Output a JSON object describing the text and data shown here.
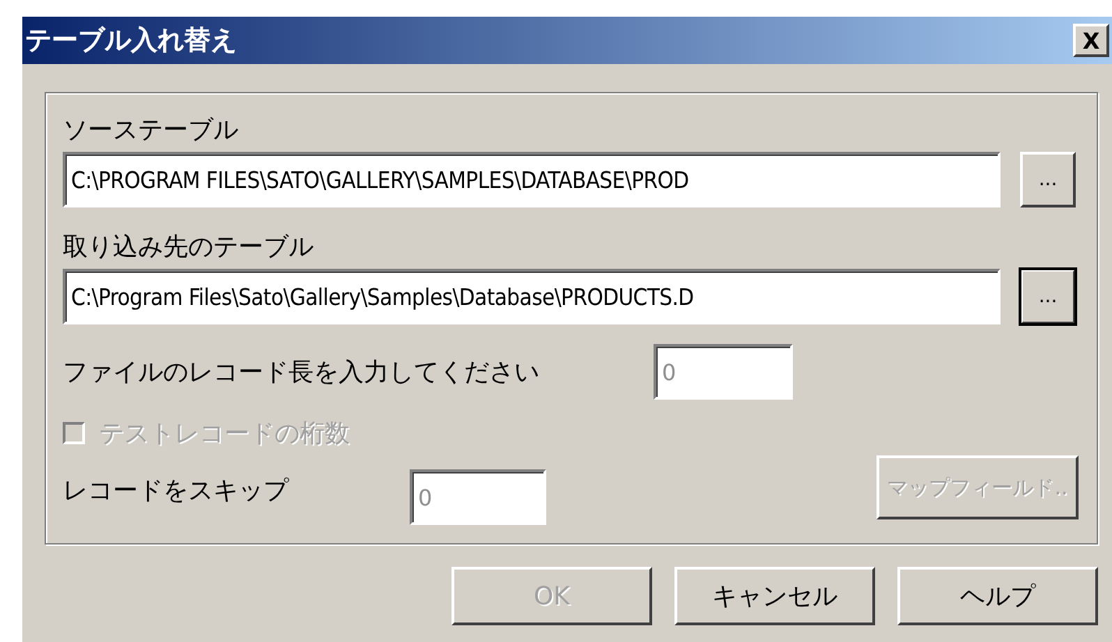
{
  "window": {
    "title": "テーブル入れ替え",
    "close": "X"
  },
  "source": {
    "label": "ソーステーブル",
    "value": "C:\\PROGRAM FILES\\SATO\\GALLERY\\SAMPLES\\DATABASE\\PROD",
    "browse": {
      "label": "...",
      "focused": false
    }
  },
  "target": {
    "label": "取り込み先のテーブル",
    "value": "C:\\Program Files\\Sato\\Gallery\\Samples\\Database\\PRODUCTS.D",
    "browse": {
      "label": "...",
      "focused": true
    }
  },
  "record_length": {
    "label": "ファイルのレコード長を入力してください",
    "value": "0",
    "disabled": true
  },
  "test_digits": {
    "label": "テストレコードの桁数",
    "checked": false,
    "disabled": true
  },
  "skip": {
    "label": "レコードをスキップ",
    "value": "0",
    "disabled": true
  },
  "map_fields": {
    "label": "マップフィールド..",
    "disabled": true
  },
  "buttons": [
    {
      "label": "OK",
      "disabled": true
    },
    {
      "label": "キャンセル",
      "disabled": false
    },
    {
      "label": "ヘルプ",
      "disabled": false
    }
  ]
}
